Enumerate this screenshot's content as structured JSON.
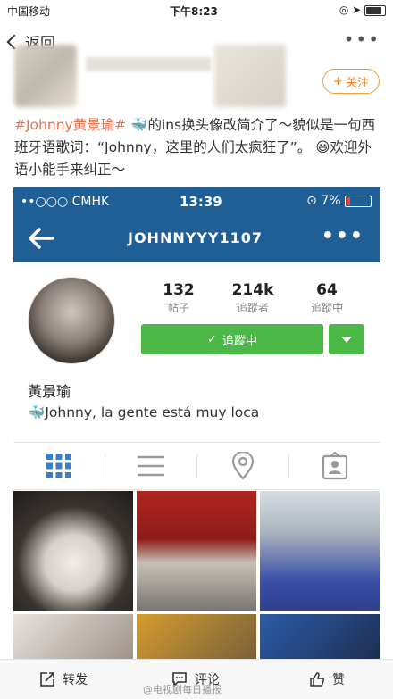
{
  "status_bar": {
    "carrier": "中国移动",
    "time": "下午8:23"
  },
  "nav": {
    "back_label": "返回",
    "more": "•••"
  },
  "header": {
    "follow_label": "关注"
  },
  "post": {
    "tag": "#Johnny黄景瑜#",
    "text": "的ins换头像改简介了～貌似是一句西班牙语歌词：“Johnny，这里的人们太疯狂了”。",
    "text2": "欢迎外语小能手来纠正～"
  },
  "ig": {
    "status": {
      "carrier": "••○○○ CMHK",
      "time": "13:39",
      "battery": "7%"
    },
    "username": "JOHNNYYY1107",
    "stats": [
      {
        "value": "132",
        "label": "帖子"
      },
      {
        "value": "214k",
        "label": "追蹤者"
      },
      {
        "value": "64",
        "label": "追蹤中"
      }
    ],
    "following_label": "追蹤中",
    "profile_name": "黃景瑜",
    "bio": "Johnny, la gente está muy loca",
    "accent": "#1f5f95",
    "green": "#4cb848"
  },
  "bottom": {
    "repost": "转发",
    "comment": "评论",
    "like": "赞",
    "watermark": "@电视剧每日播报"
  }
}
